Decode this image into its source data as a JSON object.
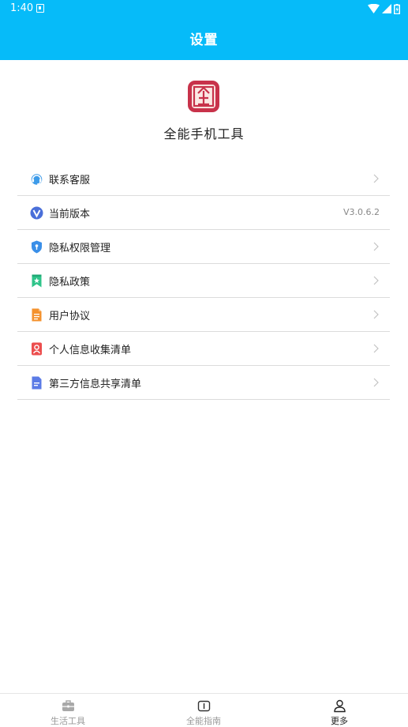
{
  "status_bar": {
    "time": "1:40"
  },
  "header": {
    "title": "设置"
  },
  "app": {
    "name": "全能手机工具"
  },
  "menu": {
    "items": [
      {
        "label": "联系客服",
        "icon": "headset-icon"
      },
      {
        "label": "当前版本",
        "value": "V3.0.6.2",
        "icon": "v-logo-icon"
      },
      {
        "label": "隐私权限管理",
        "icon": "shield-icon"
      },
      {
        "label": "隐私政策",
        "icon": "bookmark-icon"
      },
      {
        "label": "用户协议",
        "icon": "document-icon"
      },
      {
        "label": "个人信息收集清单",
        "icon": "person-card-icon"
      },
      {
        "label": "第三方信息共享清单",
        "icon": "file-icon"
      }
    ]
  },
  "bottom_nav": {
    "tabs": [
      {
        "label": "生活工具",
        "icon": "briefcase-icon",
        "active": false
      },
      {
        "label": "全能指南",
        "icon": "guide-icon",
        "active": false
      },
      {
        "label": "更多",
        "icon": "person-icon",
        "active": true
      }
    ]
  },
  "colors": {
    "accent": "#06bbf9",
    "divider": "#dcdcdc",
    "inactive_nav": "#9a9a9a"
  }
}
